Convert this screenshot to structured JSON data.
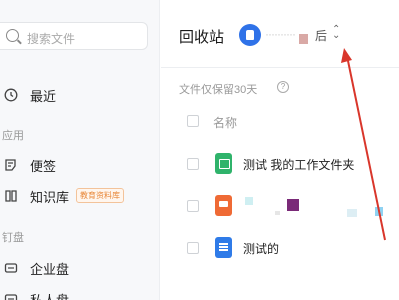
{
  "sidebar": {
    "search_placeholder": "搜索文件",
    "recent_label": "最近",
    "apps_section": "应用",
    "items": [
      {
        "label": "便签"
      },
      {
        "label": "知识库",
        "badge": "教育资料库"
      }
    ],
    "disk_section": "钉盘",
    "disks": [
      {
        "label": "企业盘"
      },
      {
        "label": "私人盘"
      }
    ]
  },
  "header": {
    "title": "回收站",
    "user_name": "··········",
    "user_suffix": "后"
  },
  "retention_note": "文件仅保留30天",
  "columns": {
    "name": "名称"
  },
  "files": [
    {
      "name": "测试 我的工作文件夹",
      "icon": "folder-icon"
    },
    {
      "name": "",
      "icon": "slides-icon"
    },
    {
      "name": "测试的",
      "icon": "doc-icon"
    }
  ],
  "colors": {
    "accent": "#2f72e8",
    "arrow": "#d9362b"
  }
}
